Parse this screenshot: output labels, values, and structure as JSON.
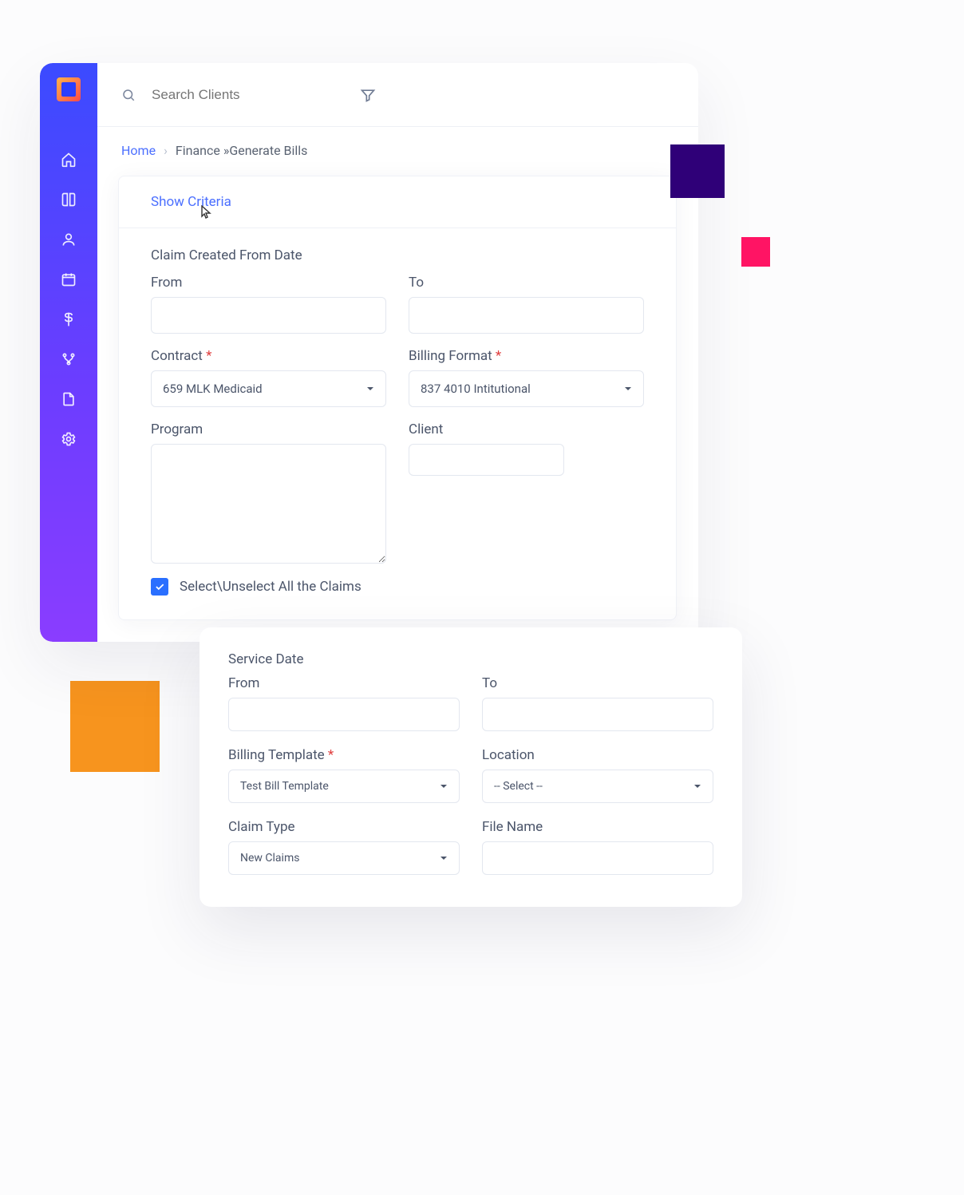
{
  "topbar": {
    "search_placeholder": "Search Clients"
  },
  "breadcrumb": {
    "home": "Home",
    "mid": "Finance",
    "tail": "Generate Bills"
  },
  "criteria": {
    "toggle_label": "Show Criteria"
  },
  "form": {
    "claim_created_section": "Claim Created From Date",
    "from_label": "From",
    "to_label": "To",
    "contract_label": "Contract",
    "contract_value": "659 MLK Medicaid",
    "billing_format_label": "Billing Format",
    "billing_format_value": "837 4010 Intitutional",
    "program_label": "Program",
    "client_label": "Client",
    "select_all_label": "Select\\Unselect All the Claims",
    "select_all_checked": true
  },
  "float": {
    "service_date_section": "Service Date",
    "from_label": "From",
    "to_label": "To",
    "billing_template_label": "Billing Template",
    "billing_template_value": "Test Bill Template",
    "location_label": "Location",
    "location_value": "-- Select --",
    "claim_type_label": "Claim Type",
    "claim_type_value": "New Claims",
    "file_name_label": "File Name"
  }
}
